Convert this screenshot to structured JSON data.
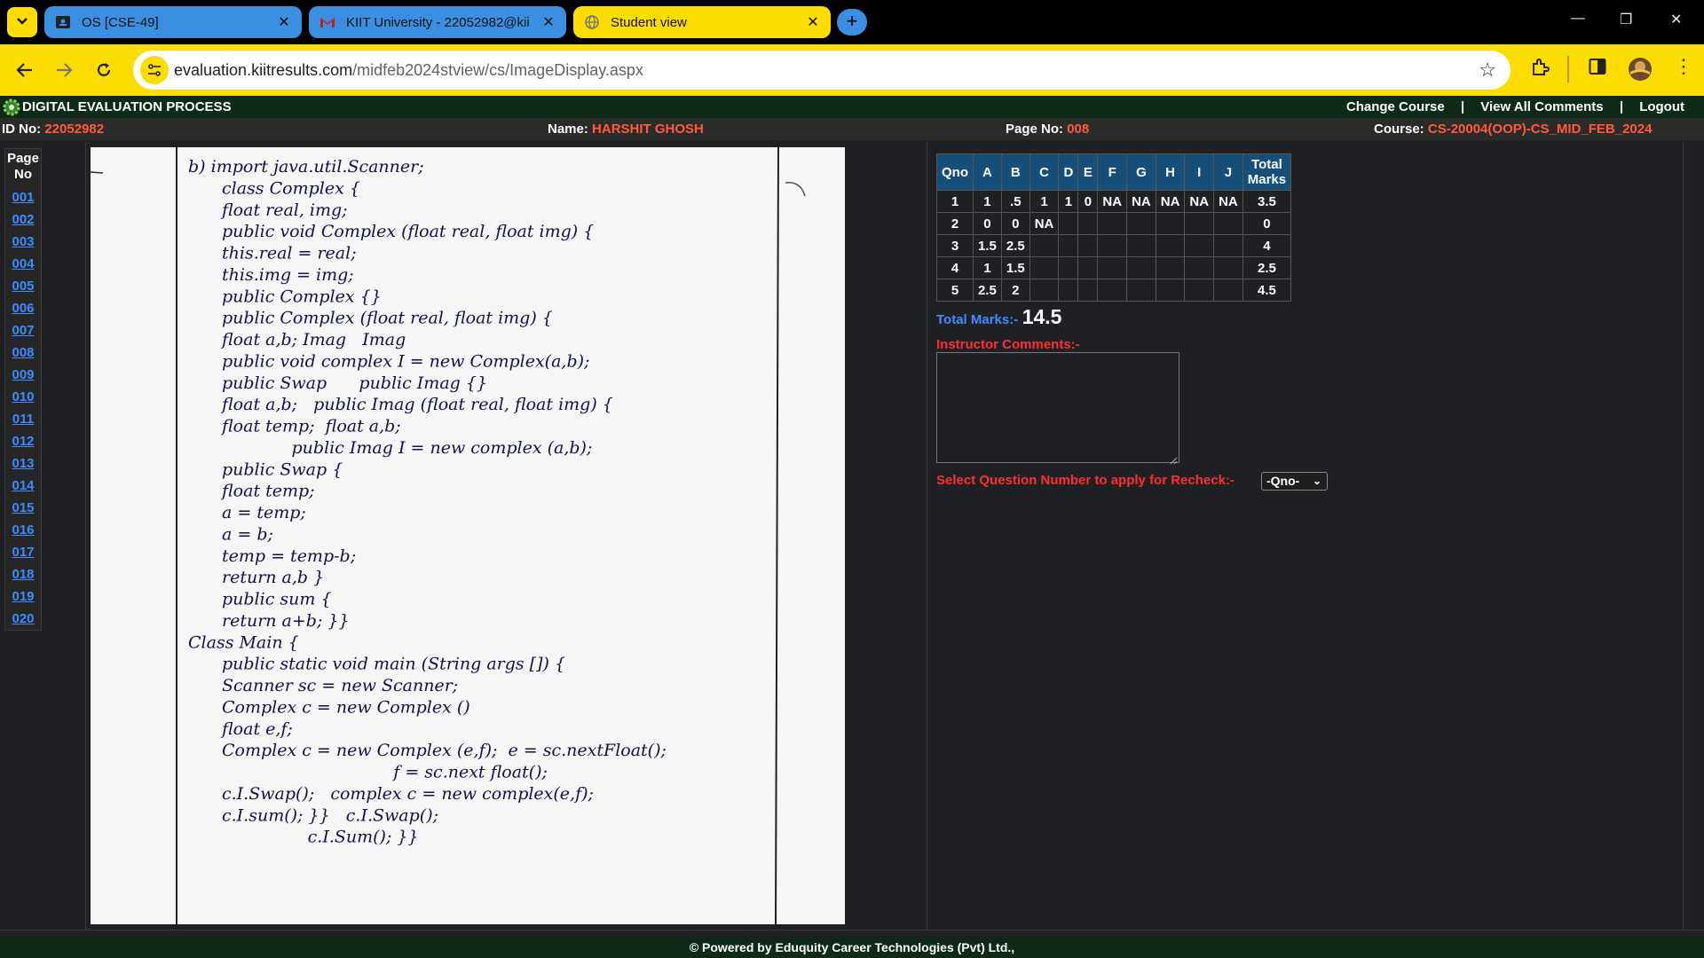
{
  "browser": {
    "tabs": [
      {
        "title": "OS [CSE-49]",
        "icon": "classroom-icon"
      },
      {
        "title": "KIIT University - 22052982@kii",
        "icon": "gmail-icon"
      },
      {
        "title": "Student view",
        "icon": "globe-icon"
      }
    ],
    "url_host": "evaluation.kiitresults.com",
    "url_path": "/midfeb2024stview/cs/ImageDisplay.aspx"
  },
  "header": {
    "title": "DIGITAL EVALUATION PROCESS",
    "change_course": "Change Course",
    "view_all_comments": "View All Comments",
    "logout": "Logout",
    "separator": "|"
  },
  "info": {
    "id_label": "ID No:",
    "id_value": "22052982",
    "name_label": "Name:",
    "name_value": "HARSHIT GHOSH",
    "page_label": "Page No:",
    "page_value": "008",
    "course_label": "Course:",
    "course_value": "CS-20004(OOP)-CS_MID_FEB_2024"
  },
  "page_nav": {
    "header": "Page No",
    "pages": [
      "001",
      "002",
      "003",
      "004",
      "005",
      "006",
      "007",
      "008",
      "009",
      "010",
      "011",
      "012",
      "013",
      "014",
      "015",
      "016",
      "017",
      "018",
      "019",
      "020"
    ]
  },
  "answer_sheet": {
    "lines": [
      "b) import java.util.Scanner;",
      "class Complex {",
      "float real, img;",
      "public void Complex (float real, float img) {",
      "this.real = real;",
      "this.img = img;",
      "public Complex {}",
      "public Complex (float real, float img) {",
      "float a,b; Imag   Imag",
      "public void complex I = new Complex(a,b);",
      "public Swap      public Imag {}",
      "float a,b;   public Imag (float real, float img) {",
      "float temp;  float a,b;",
      "             public Imag I = new complex (a,b);",
      "public Swap {",
      "float temp;",
      "a = temp;",
      "a = b;",
      "temp = temp-b;",
      "return a,b }",
      "public sum {",
      "return a+b; }}",
      "Class Main {",
      "public static void main (String args []) {",
      "Scanner sc = new Scanner;",
      "Complex c = new Complex ()",
      "float e,f;",
      "Complex c = new Complex (e,f);  e = sc.nextFloat();",
      "                                f = sc.next float();",
      "c.I.Swap();   complex c = new complex(e,f);",
      "c.I.sum(); }}   c.I.Swap();",
      "                c.I.Sum(); }}"
    ]
  },
  "marks_table": {
    "headers": [
      "Qno",
      "A",
      "B",
      "C",
      "D",
      "E",
      "F",
      "G",
      "H",
      "I",
      "J",
      "Total Marks"
    ],
    "rows": [
      [
        "1",
        "1",
        ".5",
        "1",
        "1",
        "0",
        "NA",
        "NA",
        "NA",
        "NA",
        "NA",
        "3.5"
      ],
      [
        "2",
        "0",
        "0",
        "NA",
        "",
        "",
        "",
        "",
        "",
        "",
        "",
        "0"
      ],
      [
        "3",
        "1.5",
        "2.5",
        "",
        "",
        "",
        "",
        "",
        "",
        "",
        "",
        "4"
      ],
      [
        "4",
        "1",
        "1.5",
        "",
        "",
        "",
        "",
        "",
        "",
        "",
        "",
        "2.5"
      ],
      [
        "5",
        "2.5",
        "2",
        "",
        "",
        "",
        "",
        "",
        "",
        "",
        "",
        "4.5"
      ]
    ]
  },
  "total": {
    "label": "Total Marks:-",
    "value": "14.5"
  },
  "comments": {
    "label": "Instructor Comments:-",
    "value": ""
  },
  "recheck": {
    "label": "Select Question Number to apply for Recheck:-",
    "selected": "-Qno-"
  },
  "footer": {
    "text": "© Powered by Eduquity Career Technologies (Pvt) Ltd.,"
  },
  "colors": {
    "accent_yellow": "#fddc00",
    "tab_blue": "#3a8fe0",
    "label_red": "#ff2d2d",
    "value_orange": "#ff5a3c",
    "link_blue": "#3d8bff",
    "table_header": "#164f7a"
  }
}
